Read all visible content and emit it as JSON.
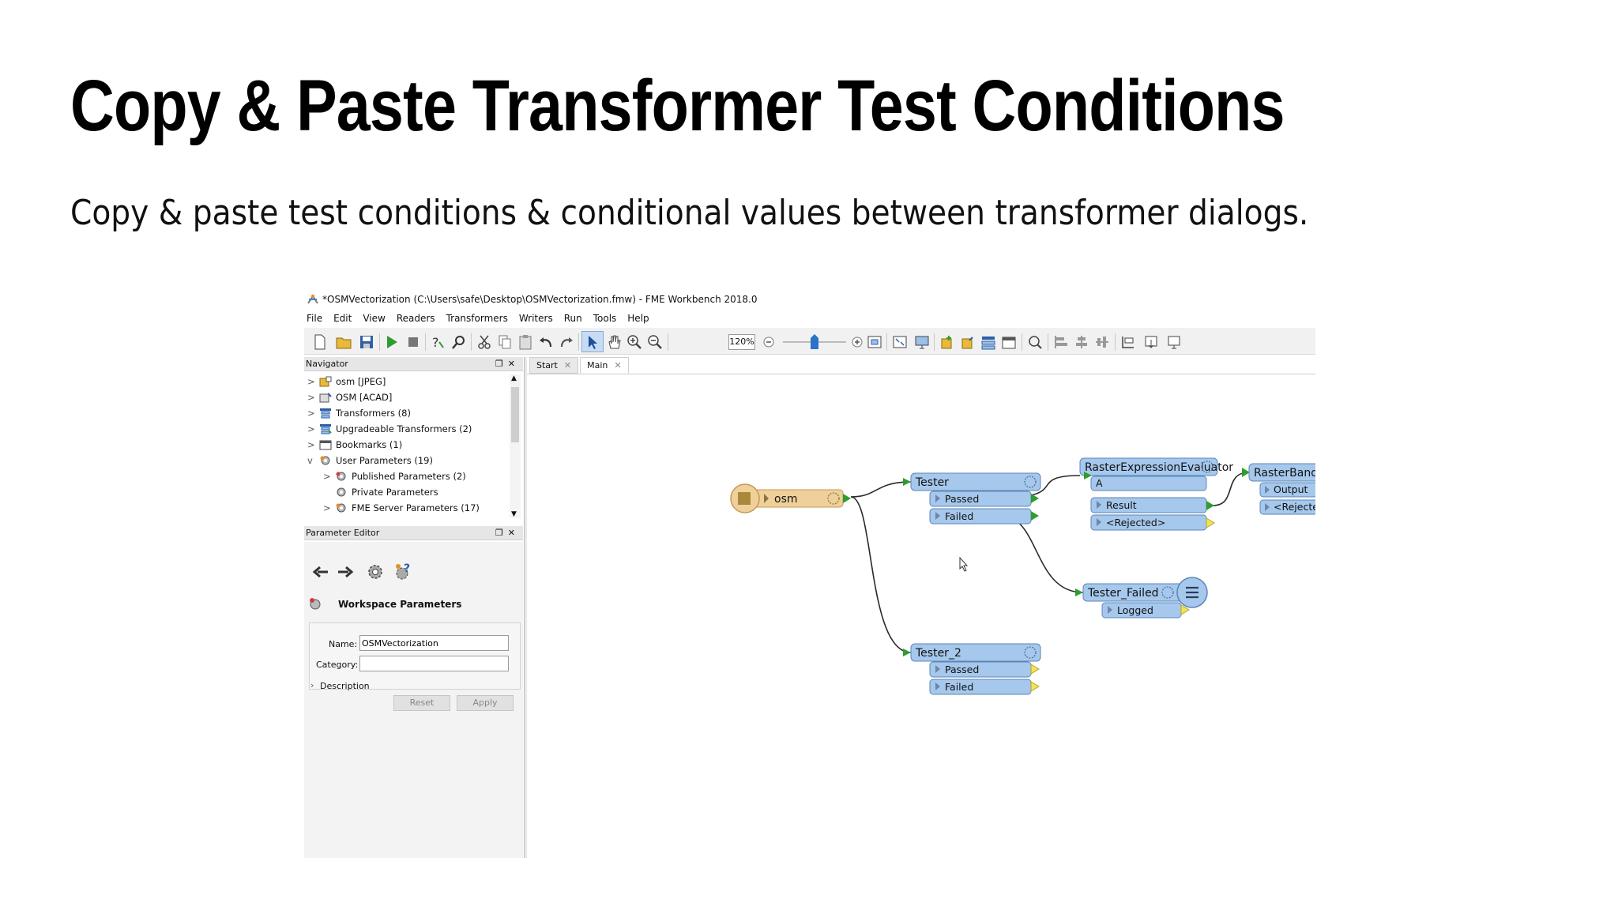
{
  "slide": {
    "title": "Copy & Paste Transformer Test Conditions",
    "subtitle": "Copy & paste test conditions & conditional values between transformer dialogs."
  },
  "window": {
    "title": "*OSMVectorization (C:\\Users\\safe\\Desktop\\OSMVectorization.fmw) - FME Workbench 2018.0"
  },
  "menu": [
    "File",
    "Edit",
    "View",
    "Readers",
    "Transformers",
    "Writers",
    "Run",
    "Tools",
    "Help"
  ],
  "toolbar": {
    "zoom": "120%"
  },
  "navigator": {
    "title": "Navigator",
    "items": [
      {
        "label": "osm [JPEG]",
        "expand": ">"
      },
      {
        "label": "OSM [ACAD]",
        "expand": ">"
      },
      {
        "label": "Transformers (8)",
        "expand": ">"
      },
      {
        "label": "Upgradeable Transformers (2)",
        "expand": ">"
      },
      {
        "label": "Bookmarks (1)",
        "expand": ">"
      },
      {
        "label": "User Parameters (19)",
        "expand": "v"
      },
      {
        "label": "Published Parameters (2)",
        "expand": ">"
      },
      {
        "label": "Private Parameters",
        "expand": ""
      },
      {
        "label": "FME Server Parameters (17)",
        "expand": ">"
      }
    ]
  },
  "parameter_editor": {
    "title": "Parameter Editor",
    "heading": "Workspace Parameters",
    "name_label": "Name:",
    "name_value": "OSMVectorization",
    "category_label": "Category:",
    "category_value": "",
    "description_label": "Description",
    "reset_label": "Reset",
    "apply_label": "Apply"
  },
  "tabs": [
    {
      "label": "Start"
    },
    {
      "label": "Main"
    }
  ],
  "canvas": {
    "reader": "osm",
    "tester": {
      "name": "Tester",
      "ports": [
        "Passed",
        "Failed"
      ]
    },
    "tester2": {
      "name": "Tester_2",
      "ports": [
        "Passed",
        "Failed"
      ]
    },
    "raster_eval": {
      "name": "RasterExpressionEvaluator",
      "input": "A",
      "ports": [
        "Result",
        "<Rejected>"
      ]
    },
    "raster_band": {
      "name": "RasterBandNodat",
      "ports": [
        "Output",
        "<Rejected>"
      ]
    },
    "tester_failed": {
      "name": "Tester_Failed",
      "ports": [
        "Logged"
      ]
    }
  },
  "colors": {
    "transformer_fill": "#a6c8ec",
    "transformer_border": "#5b86b8",
    "reader_fill": "#f0d09a",
    "reader_border": "#c59a55",
    "connector": "#2a2a2a",
    "arrow_green": "#2e9d2e",
    "port_yellow": "#f2e35a"
  }
}
